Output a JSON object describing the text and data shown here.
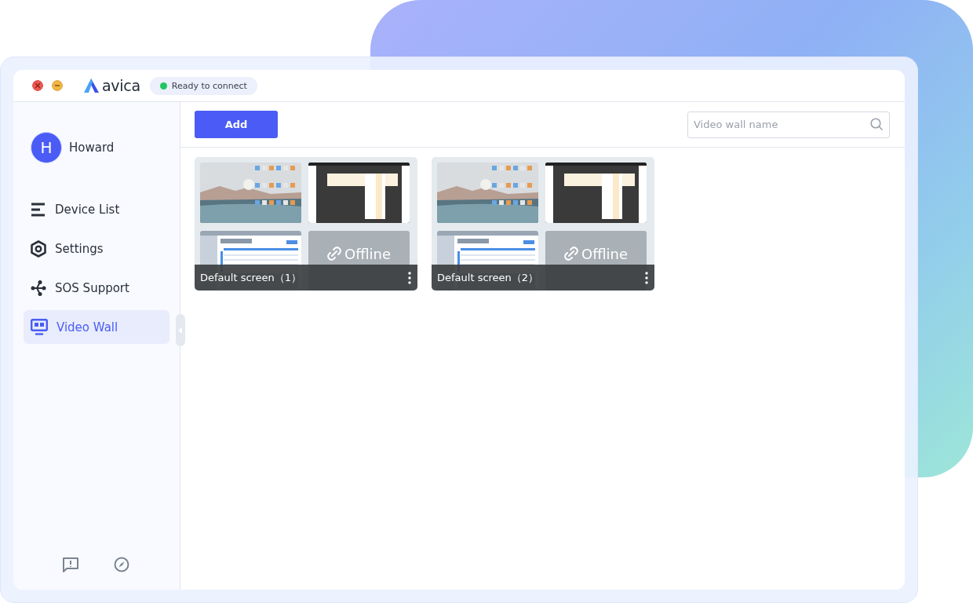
{
  "window": {
    "logo": "avica",
    "status": {
      "text": "Ready to connect",
      "color": "#22c55e"
    }
  },
  "user": {
    "initial": "H",
    "name": "Howard"
  },
  "sidebar": {
    "items": [
      {
        "label": "Device List",
        "kind": "list",
        "selected": false
      },
      {
        "label": "Settings",
        "kind": "gear",
        "selected": false
      },
      {
        "label": "SOS Support",
        "kind": "nodes",
        "selected": false
      },
      {
        "label": "Video Wall",
        "kind": "monitor",
        "selected": true
      }
    ]
  },
  "toolbar": {
    "add_button": "Add",
    "search": {
      "placeholder": "Video wall name"
    }
  },
  "walls": [
    {
      "name": "Default screen（1）",
      "screens": [
        {
          "kind": "desktop"
        },
        {
          "kind": "app"
        },
        {
          "kind": "web"
        },
        {
          "kind": "offline",
          "label": "Offline"
        }
      ]
    },
    {
      "name": "Default screen（2）",
      "screens": [
        {
          "kind": "desktop"
        },
        {
          "kind": "app"
        },
        {
          "kind": "web"
        },
        {
          "kind": "offline",
          "label": "Offline"
        }
      ]
    }
  ]
}
